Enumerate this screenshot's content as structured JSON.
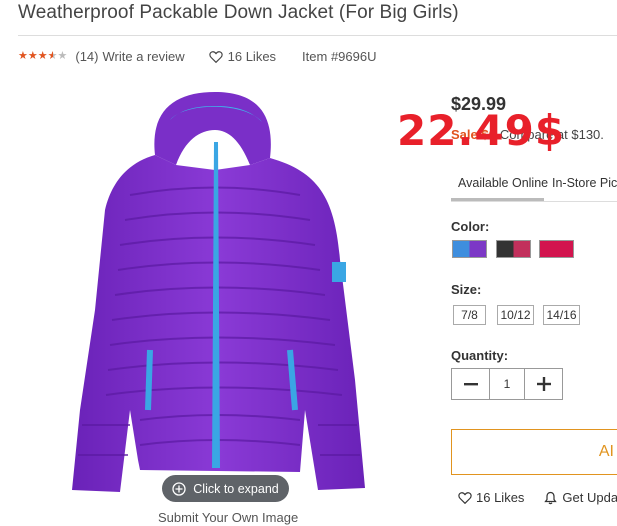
{
  "product": {
    "title": "Weatherproof Packable Down Jacket (For Big Girls)",
    "rating": {
      "stars": 3.5,
      "out_of": 5,
      "review_count": "(14)",
      "review_link": "Write a review"
    },
    "likes": "16 Likes",
    "item_number": "Item #9696U"
  },
  "image": {
    "expand_label": "Click to expand",
    "submit_label": "Submit Your Own Image"
  },
  "pricing": {
    "price": "$29.99",
    "sale_label": "Sale $0",
    "compare": "Compare at $130.",
    "overlay_price": "22.49$"
  },
  "fulfillment": {
    "tabs": [
      "Available Online",
      "In-Store Picku"
    ]
  },
  "color": {
    "label": "Color:",
    "swatches": [
      {
        "name": "blue-purple",
        "colors": [
          "#3e8ede",
          "#7c38c6"
        ]
      },
      {
        "name": "black-pink",
        "colors": [
          "#333333",
          "#c2305c"
        ]
      },
      {
        "name": "pink",
        "colors": [
          "#d2144e",
          "#e23866"
        ]
      }
    ]
  },
  "size": {
    "label": "Size:",
    "options": [
      "7/8",
      "10/12",
      "14/16"
    ]
  },
  "quantity": {
    "label": "Quantity:",
    "value": "1"
  },
  "cta": {
    "add_label": "AI"
  },
  "actions": {
    "likes": "16 Likes",
    "updates": "Get Upda"
  },
  "colors": {
    "accent": "#e1541f",
    "cta": "#e1941f",
    "overlay": "#e8202a",
    "jacket": "#7e2fc9",
    "zipper": "#3aa6e4"
  }
}
